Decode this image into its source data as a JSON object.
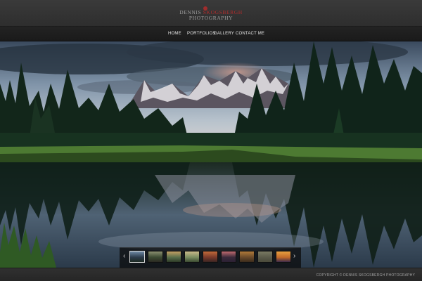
{
  "site": {
    "logo_line1_a": "DENNIS ",
    "logo_line1_b": "SKOGSBERGH",
    "logo_line2": "PHOTOGRAPHY",
    "accent_color": "#b22c2c"
  },
  "nav": {
    "items": [
      {
        "label": "HOME"
      },
      {
        "label": "PORTFOLIOS"
      },
      {
        "label": "GALLERY"
      },
      {
        "label": "CONTACT ME"
      }
    ]
  },
  "hero": {
    "subject": "Mountain lake reflection landscape"
  },
  "thumbnails": {
    "prev_icon": "chevron-left-icon",
    "next_icon": "chevron-right-icon",
    "prev_glyph": "‹",
    "next_glyph": "›",
    "active_index": 0,
    "items": [
      {
        "colors": [
          "#2c3b4b",
          "#6f8aa6",
          "#1d2a22"
        ]
      },
      {
        "colors": [
          "#3c4a32",
          "#8a8f70",
          "#2a2a22"
        ]
      },
      {
        "colors": [
          "#5a6f4a",
          "#c3a063",
          "#2c3a28"
        ]
      },
      {
        "colors": [
          "#7a8c60",
          "#c8b98a",
          "#3a4a30"
        ]
      },
      {
        "colors": [
          "#7a3a2a",
          "#c26a3a",
          "#3a2422"
        ]
      },
      {
        "colors": [
          "#3b2a3a",
          "#c06a70",
          "#2a2034"
        ]
      },
      {
        "colors": [
          "#6a4a2a",
          "#b07a3a",
          "#3a2c1c"
        ]
      },
      {
        "colors": [
          "#5a5a4a",
          "#7a7a62",
          "#4a4a3a"
        ]
      },
      {
        "colors": [
          "#c36a2a",
          "#e8a040",
          "#3a2a4a"
        ]
      }
    ]
  },
  "footer": {
    "copyright": "COPYRIGHT © DENNIS SKOGSBERGH PHOTOGRAPHY"
  }
}
